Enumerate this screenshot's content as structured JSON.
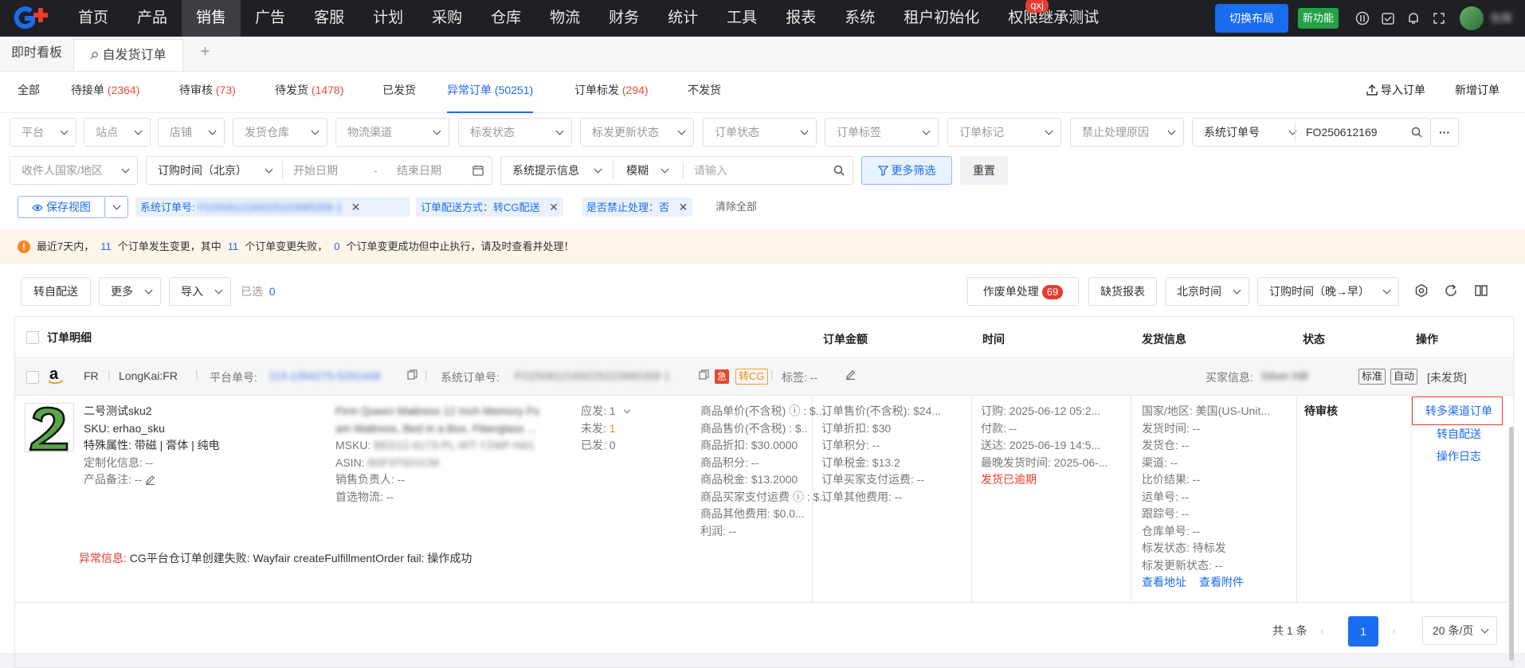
{
  "nav": {
    "items": [
      "首页",
      "产品",
      "销售",
      "广告",
      "客服",
      "计划",
      "采购",
      "仓库",
      "物流",
      "财务",
      "统计",
      "工具",
      "报表",
      "系统",
      "租户初始化",
      "权限继承测试"
    ],
    "badge": "qxj",
    "switch_layout": "切换布局",
    "new_feature": "新功能",
    "user": "张辉"
  },
  "pagetabs": {
    "dashboard": "即时看板",
    "current": "自发货订单",
    "add": "+"
  },
  "subtabs": [
    {
      "label": "全部",
      "count": ""
    },
    {
      "label": "待接单",
      "count": "(2364)"
    },
    {
      "label": "待审核",
      "count": "(73)"
    },
    {
      "label": "待发货",
      "count": "(1478)"
    },
    {
      "label": "已发货",
      "count": ""
    },
    {
      "label": "异常订单",
      "count": "(50251)"
    },
    {
      "label": "订单标发",
      "count": "(294)"
    },
    {
      "label": "不发货",
      "count": ""
    }
  ],
  "top_actions": {
    "import_order": "导入订单",
    "new_order": "新增订单"
  },
  "filters_row1": [
    "平台",
    "站点",
    "店铺",
    "发货仓库",
    "物流渠道",
    "标发状态",
    "标发更新状态",
    "订单状态",
    "订单标签",
    "订单标记",
    "禁止处理原因"
  ],
  "search": {
    "field": "系统订单号",
    "value": "FO250612169"
  },
  "filters_row2": {
    "country": "收件人国家/地区",
    "time_type": "订购时间（北京）",
    "start": "开始日期",
    "dash": "-",
    "end": "结束日期",
    "hint": "系统提示信息",
    "mode": "模糊",
    "input_placeholder": "请输入",
    "more": "更多筛选",
    "reset": "重置"
  },
  "chips": {
    "save_view": "保存视图",
    "c1_label": "系统订单号:",
    "c1_value": "FO250612169225223985358 1",
    "c2": "订单配送方式：转CG配送",
    "c3": "是否禁止处理：否",
    "clear": "清除全部"
  },
  "warning": {
    "p1": "最近7天内，",
    "n1": "11",
    "p2": "个订单发生变更，其中",
    "n2": "11",
    "p3": "个订单变更失败，",
    "n3": "0",
    "p4": "个订单变更成功但中止执行，请及时查看并处理！"
  },
  "toolbar": {
    "to_self": "转自配送",
    "more": "更多",
    "import": "导入",
    "selected_label": "已选",
    "selected_count": "0",
    "void": "作废单处理",
    "void_count": "69",
    "shortage": "缺货报表",
    "timezone": "北京时间",
    "sort": "订购时间（晚→早）"
  },
  "table": {
    "headers": {
      "detail": "订单明细",
      "amount": "订单金额",
      "time": "时间",
      "ship": "发货信息",
      "status": "状态",
      "ops": "操作"
    },
    "order": {
      "site": "FR",
      "shop": "LongKai:FR",
      "platform_no_label": "平台单号:",
      "platform_no": "113-1394275-5291448",
      "sys_no_label": "系统订单号:",
      "sys_no": "FO250612169225223985358 1",
      "tag_urgent": "急",
      "tag_cg": "转CG",
      "label_text": "标签: --",
      "buyer_label": "买家信息:",
      "buyer": "Silver Hill",
      "tag_std": "标准",
      "tag_auto": "自动",
      "unshipped": "[未发货]",
      "product": {
        "name": "二号测试sku2",
        "sku": "SKU:  erhao_sku",
        "special": "特殊属性:  带磁 | 膏体 | 纯电",
        "custom": "定制化信息:  --",
        "remark": "产品备注:  --"
      },
      "listing": {
        "title1": "Firm Queen Mattress 12 Inch Memory Fo",
        "title2": "am Mattress, Bed in a Box, Fiberglass ...",
        "msku_label": "MSKU:",
        "msku": "BED12-6173-PL-WT-Y2WF-N61",
        "asin_label": "ASIN:",
        "asin": "B0F3T5D1CM",
        "sales": "销售负责人:  --",
        "logistics": "首选物流:  --"
      },
      "qty": {
        "should": "应发:  1",
        "unsent_label": "未发:",
        "unsent": "1",
        "sent": "已发:  0"
      },
      "price": [
        "商品单价(不含税)  ⓘ :  $...",
        "商品售价(不含税)  :  $..",
        "商品折扣:  $30.0000",
        "商品积分:  --",
        "商品税金:  $13.2000",
        "商品买家支付运费  ⓘ :  $...",
        "商品其他费用:  $0.0...",
        "利润:  --"
      ],
      "amount": [
        "订单售价(不含税):  $24...",
        "订单折扣:  $30",
        "订单积分:  --",
        "订单税金:  $13.2",
        "订单买家支付运费:  --",
        "订单其他费用:  --"
      ],
      "times": [
        "订购:  2025-06-12 05:2...",
        "付款:  --",
        "送达:  2025-06-19 14:5...",
        "最晚发货时间:  2025-06-..."
      ],
      "overdue": "发货已逾期",
      "ship": [
        "国家/地区:  美国(US-Unit...",
        "发货时间:  --",
        "发货仓:  --",
        "渠道:  --",
        "比价结果:  --",
        "运单号:  --",
        "跟踪号:  --",
        "仓库单号:  --",
        "标发状态:  待标发",
        "标发更新状态:  --"
      ],
      "view_address": "查看地址",
      "view_attach": "查看附件",
      "status": "待审核",
      "ops": [
        "转多渠道订单",
        "转自配送",
        "操作日志"
      ],
      "error_label": "异常信息:",
      "error_text": "CG平台仓订单创建失败: Wayfair createFulfillmentOrder fail: 操作成功"
    }
  },
  "pager": {
    "total": "共 1 条",
    "page": "1",
    "per_page": "20 条/页"
  },
  "colors": {
    "accent": "#1a6cf0",
    "danger": "#e63c2f",
    "warn_bg": "#fdf4ea",
    "nav_bg": "#1f2023"
  }
}
